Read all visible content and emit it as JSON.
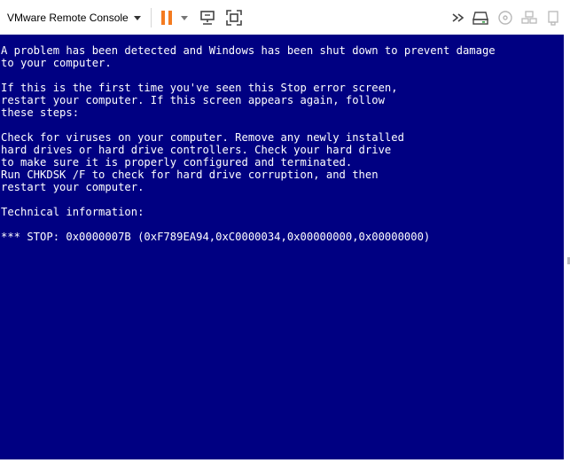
{
  "toolbar": {
    "menu_label": "VMware Remote Console",
    "colors": {
      "pause": "#f47b20",
      "icon": "#555555",
      "icon_disabled": "#b8b8b8",
      "screen_bg": "#000082",
      "screen_text": "#ffffff"
    },
    "icons": [
      "pause-icon",
      "power-dropdown-icon",
      "send-ctrl-alt-del-icon",
      "fullscreen-icon",
      "forward-chevrons-icon",
      "removable-devices-icon",
      "cd-dvd-icon",
      "network-icon"
    ]
  },
  "bsod": {
    "lines": [
      "A problem has been detected and Windows has been shut down to prevent damage",
      "to your computer.",
      "",
      "If this is the first time you've seen this Stop error screen,",
      "restart your computer. If this screen appears again, follow",
      "these steps:",
      "",
      "Check for viruses on your computer. Remove any newly installed",
      "hard drives or hard drive controllers. Check your hard drive",
      "to make sure it is properly configured and terminated.",
      "Run CHKDSK /F to check for hard drive corruption, and then",
      "restart your computer.",
      "",
      "Technical information:",
      "",
      "*** STOP: 0x0000007B (0xF789EA94,0xC0000034,0x00000000,0x00000000)"
    ]
  }
}
